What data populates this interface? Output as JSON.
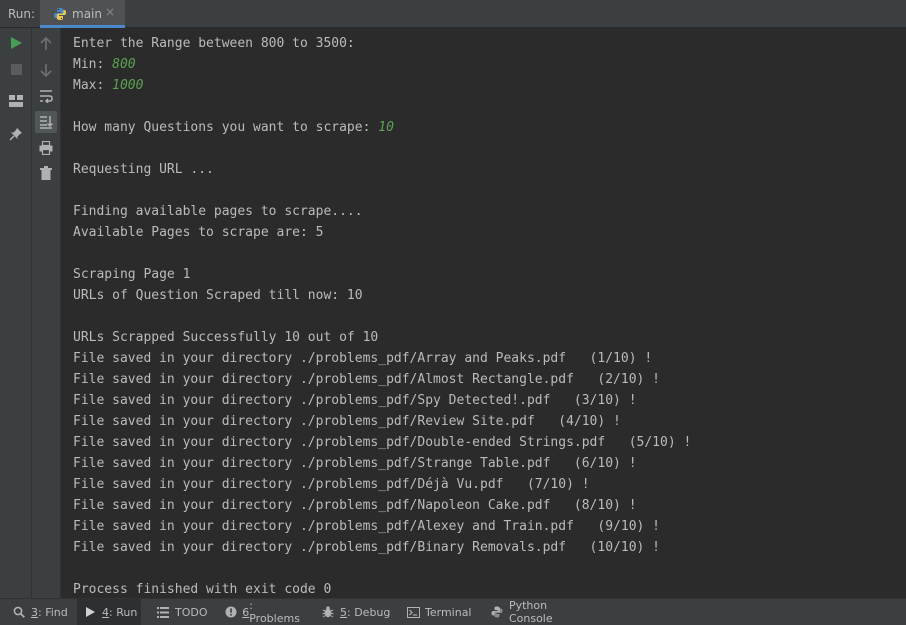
{
  "topbar": {
    "run_label": "Run:",
    "tab_label": "main",
    "close_glyph": "×"
  },
  "console_lines": [
    {
      "text": "Enter the Range between 800 to 3500:",
      "input": ""
    },
    {
      "text": "Min: ",
      "input": "800"
    },
    {
      "text": "Max: ",
      "input": "1000"
    },
    {
      "text": "",
      "input": ""
    },
    {
      "text": "How many Questions you want to scrape: ",
      "input": "10"
    },
    {
      "text": "",
      "input": ""
    },
    {
      "text": "Requesting URL ...",
      "input": ""
    },
    {
      "text": "",
      "input": ""
    },
    {
      "text": "Finding available pages to scrape....",
      "input": ""
    },
    {
      "text": "Available Pages to scrape are: 5",
      "input": ""
    },
    {
      "text": "",
      "input": ""
    },
    {
      "text": "Scraping Page 1",
      "input": ""
    },
    {
      "text": "URLs of Question Scraped till now: 10",
      "input": ""
    },
    {
      "text": "",
      "input": ""
    },
    {
      "text": "URLs Scrapped Successfully 10 out of 10",
      "input": ""
    },
    {
      "text": "File saved in your directory ./problems_pdf/Array and Peaks.pdf   (1/10) !",
      "input": ""
    },
    {
      "text": "File saved in your directory ./problems_pdf/Almost Rectangle.pdf   (2/10) !",
      "input": ""
    },
    {
      "text": "File saved in your directory ./problems_pdf/Spy Detected!.pdf   (3/10) !",
      "input": ""
    },
    {
      "text": "File saved in your directory ./problems_pdf/Review Site.pdf   (4/10) !",
      "input": ""
    },
    {
      "text": "File saved in your directory ./problems_pdf/Double-ended Strings.pdf   (5/10) !",
      "input": ""
    },
    {
      "text": "File saved in your directory ./problems_pdf/Strange Table.pdf   (6/10) !",
      "input": ""
    },
    {
      "text": "File saved in your directory ./problems_pdf/Déjà Vu.pdf   (7/10) !",
      "input": ""
    },
    {
      "text": "File saved in your directory ./problems_pdf/Napoleon Cake.pdf   (8/10) !",
      "input": ""
    },
    {
      "text": "File saved in your directory ./problems_pdf/Alexey and Train.pdf   (9/10) !",
      "input": ""
    },
    {
      "text": "File saved in your directory ./problems_pdf/Binary Removals.pdf   (10/10) !",
      "input": ""
    },
    {
      "text": "",
      "input": ""
    },
    {
      "text": "Process finished with exit code 0",
      "input": ""
    }
  ],
  "bottom_tabs": [
    {
      "key": "3",
      "label": ": Find",
      "icon": "search-icon"
    },
    {
      "key": "4",
      "label": ": Run",
      "icon": "play-icon",
      "active": true
    },
    {
      "key": "",
      "label": "TODO",
      "icon": "list-icon"
    },
    {
      "key": "6",
      "label": ": Problems",
      "icon": "info-icon"
    },
    {
      "key": "5",
      "label": ": Debug",
      "icon": "bug-icon"
    },
    {
      "key": "",
      "label": "Terminal",
      "icon": "terminal-icon"
    },
    {
      "key": "",
      "label": "Python Console",
      "icon": "python-icon"
    }
  ],
  "colors": {
    "background": "#2b2b2b",
    "panel": "#3c3f41",
    "text": "#bbbbbb",
    "input": "#5ca152",
    "accent": "#4a88c7",
    "run_green": "#499c54"
  }
}
